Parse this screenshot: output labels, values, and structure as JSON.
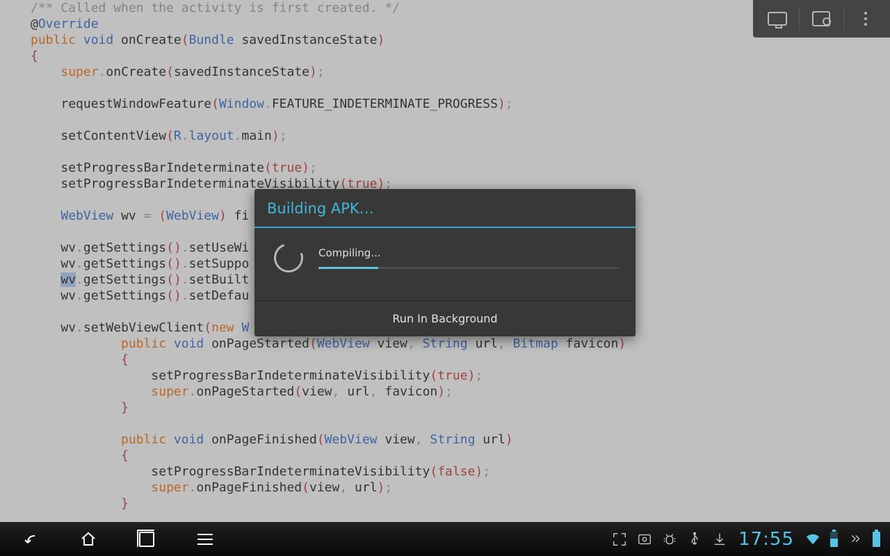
{
  "code": {
    "lines": [
      {
        "indent": 0,
        "tokens": [
          {
            "t": "/** Called when the activity is first created. */",
            "c": "kw-comment"
          }
        ]
      },
      {
        "indent": 0,
        "tokens": [
          {
            "t": "@",
            "c": ""
          },
          {
            "t": "Override",
            "c": "kw-blue"
          }
        ]
      },
      {
        "indent": 0,
        "tokens": [
          {
            "t": "public ",
            "c": "kw-orange"
          },
          {
            "t": "void ",
            "c": "kw-blue"
          },
          {
            "t": "onCreate"
          },
          {
            "t": "(",
            "c": "kw-red"
          },
          {
            "t": "Bundle ",
            "c": "kw-blue"
          },
          {
            "t": "savedInstanceState"
          },
          {
            "t": ")",
            "c": "kw-red"
          }
        ]
      },
      {
        "indent": 0,
        "tokens": [
          {
            "t": "{",
            "c": "kw-red"
          }
        ]
      },
      {
        "indent": 1,
        "tokens": [
          {
            "t": "super",
            "c": "kw-orange"
          },
          {
            "t": ".",
            "c": "kw-grey"
          },
          {
            "t": "onCreate"
          },
          {
            "t": "(",
            "c": "kw-red"
          },
          {
            "t": "savedInstanceState"
          },
          {
            "t": ")",
            "c": "kw-red"
          },
          {
            "t": ";",
            "c": "kw-grey"
          }
        ]
      },
      {
        "indent": 0,
        "tokens": []
      },
      {
        "indent": 1,
        "tokens": [
          {
            "t": "requestWindowFeature"
          },
          {
            "t": "(",
            "c": "kw-red"
          },
          {
            "t": "Window",
            "c": "kw-blue"
          },
          {
            "t": ".",
            "c": "kw-grey"
          },
          {
            "t": "FEATURE_INDETERMINATE_PROGRESS"
          },
          {
            "t": ")",
            "c": "kw-red"
          },
          {
            "t": ";",
            "c": "kw-grey"
          }
        ]
      },
      {
        "indent": 0,
        "tokens": []
      },
      {
        "indent": 1,
        "tokens": [
          {
            "t": "setContentView"
          },
          {
            "t": "(",
            "c": "kw-red"
          },
          {
            "t": "R",
            "c": "kw-blue"
          },
          {
            "t": ".",
            "c": "kw-grey"
          },
          {
            "t": "layout",
            "c": "kw-blue"
          },
          {
            "t": ".",
            "c": "kw-grey"
          },
          {
            "t": "main"
          },
          {
            "t": ")",
            "c": "kw-red"
          },
          {
            "t": ";",
            "c": "kw-grey"
          }
        ]
      },
      {
        "indent": 0,
        "tokens": []
      },
      {
        "indent": 1,
        "tokens": [
          {
            "t": "setProgressBarIndeterminate"
          },
          {
            "t": "(",
            "c": "kw-red"
          },
          {
            "t": "true",
            "c": "kw-redb"
          },
          {
            "t": ")",
            "c": "kw-red"
          },
          {
            "t": ";",
            "c": "kw-grey"
          }
        ]
      },
      {
        "indent": 1,
        "tokens": [
          {
            "t": "setProgressBarIndeterminateVisibility"
          },
          {
            "t": "(",
            "c": "kw-red"
          },
          {
            "t": "true",
            "c": "kw-redb"
          },
          {
            "t": ")",
            "c": "kw-red"
          },
          {
            "t": ";",
            "c": "kw-grey"
          }
        ]
      },
      {
        "indent": 0,
        "tokens": []
      },
      {
        "indent": 1,
        "tokens": [
          {
            "t": "WebView ",
            "c": "kw-blue"
          },
          {
            "t": "wv "
          },
          {
            "t": "= ",
            "c": "kw-grey"
          },
          {
            "t": "(",
            "c": "kw-red"
          },
          {
            "t": "WebView",
            "c": "kw-blue"
          },
          {
            "t": ") ",
            "c": "kw-red"
          },
          {
            "t": "fi"
          }
        ]
      },
      {
        "indent": 0,
        "tokens": []
      },
      {
        "indent": 1,
        "tokens": [
          {
            "t": "wv"
          },
          {
            "t": ".",
            "c": "kw-grey"
          },
          {
            "t": "getSettings"
          },
          {
            "t": "()",
            "c": "kw-red"
          },
          {
            "t": ".",
            "c": "kw-grey"
          },
          {
            "t": "setUseWi"
          }
        ]
      },
      {
        "indent": 1,
        "tokens": [
          {
            "t": "wv"
          },
          {
            "t": ".",
            "c": "kw-grey"
          },
          {
            "t": "getSettings"
          },
          {
            "t": "()",
            "c": "kw-red"
          },
          {
            "t": ".",
            "c": "kw-grey"
          },
          {
            "t": "setSuppo"
          }
        ]
      },
      {
        "indent": 1,
        "tokens": [
          {
            "t": "wv",
            "c": "hl"
          },
          {
            "t": ".",
            "c": "kw-grey"
          },
          {
            "t": "getSettings"
          },
          {
            "t": "()",
            "c": "kw-red"
          },
          {
            "t": ".",
            "c": "kw-grey"
          },
          {
            "t": "setBuilt"
          }
        ]
      },
      {
        "indent": 1,
        "tokens": [
          {
            "t": "wv"
          },
          {
            "t": ".",
            "c": "kw-grey"
          },
          {
            "t": "getSettings"
          },
          {
            "t": "()",
            "c": "kw-red"
          },
          {
            "t": ".",
            "c": "kw-grey"
          },
          {
            "t": "setDefau"
          }
        ]
      },
      {
        "indent": 0,
        "tokens": []
      },
      {
        "indent": 1,
        "tokens": [
          {
            "t": "wv"
          },
          {
            "t": ".",
            "c": "kw-grey"
          },
          {
            "t": "setWebViewClient"
          },
          {
            "t": "(",
            "c": "kw-red"
          },
          {
            "t": "new ",
            "c": "kw-orange"
          },
          {
            "t": "W",
            "c": "kw-blue"
          }
        ]
      },
      {
        "indent": 3,
        "tokens": [
          {
            "t": "public ",
            "c": "kw-orange"
          },
          {
            "t": "void ",
            "c": "kw-blue"
          },
          {
            "t": "onPageStarted"
          },
          {
            "t": "(",
            "c": "kw-red"
          },
          {
            "t": "WebView ",
            "c": "kw-blue"
          },
          {
            "t": "view"
          },
          {
            "t": ", ",
            "c": "kw-grey"
          },
          {
            "t": "String ",
            "c": "kw-blue"
          },
          {
            "t": "url"
          },
          {
            "t": ", ",
            "c": "kw-grey"
          },
          {
            "t": "Bitmap ",
            "c": "kw-blue"
          },
          {
            "t": "favicon"
          },
          {
            "t": ")",
            "c": "kw-red"
          }
        ]
      },
      {
        "indent": 3,
        "tokens": [
          {
            "t": "{",
            "c": "kw-red"
          }
        ]
      },
      {
        "indent": 4,
        "tokens": [
          {
            "t": "setProgressBarIndeterminateVisibility"
          },
          {
            "t": "(",
            "c": "kw-red"
          },
          {
            "t": "true",
            "c": "kw-redb"
          },
          {
            "t": ")",
            "c": "kw-red"
          },
          {
            "t": ";",
            "c": "kw-grey"
          }
        ]
      },
      {
        "indent": 4,
        "tokens": [
          {
            "t": "super",
            "c": "kw-orange"
          },
          {
            "t": ".",
            "c": "kw-grey"
          },
          {
            "t": "onPageStarted"
          },
          {
            "t": "(",
            "c": "kw-red"
          },
          {
            "t": "view"
          },
          {
            "t": ", ",
            "c": "kw-grey"
          },
          {
            "t": "url"
          },
          {
            "t": ", ",
            "c": "kw-grey"
          },
          {
            "t": "favicon"
          },
          {
            "t": ")",
            "c": "kw-red"
          },
          {
            "t": ";",
            "c": "kw-grey"
          }
        ]
      },
      {
        "indent": 3,
        "tokens": [
          {
            "t": "}",
            "c": "kw-red"
          }
        ]
      },
      {
        "indent": 0,
        "tokens": []
      },
      {
        "indent": 3,
        "tokens": [
          {
            "t": "public ",
            "c": "kw-orange"
          },
          {
            "t": "void ",
            "c": "kw-blue"
          },
          {
            "t": "onPageFinished"
          },
          {
            "t": "(",
            "c": "kw-red"
          },
          {
            "t": "WebView ",
            "c": "kw-blue"
          },
          {
            "t": "view"
          },
          {
            "t": ", ",
            "c": "kw-grey"
          },
          {
            "t": "String ",
            "c": "kw-blue"
          },
          {
            "t": "url"
          },
          {
            "t": ")",
            "c": "kw-red"
          }
        ]
      },
      {
        "indent": 3,
        "tokens": [
          {
            "t": "{",
            "c": "kw-red"
          }
        ]
      },
      {
        "indent": 4,
        "tokens": [
          {
            "t": "setProgressBarIndeterminateVisibility"
          },
          {
            "t": "(",
            "c": "kw-red"
          },
          {
            "t": "false",
            "c": "kw-redb"
          },
          {
            "t": ")",
            "c": "kw-red"
          },
          {
            "t": ";",
            "c": "kw-grey"
          }
        ]
      },
      {
        "indent": 4,
        "tokens": [
          {
            "t": "super",
            "c": "kw-orange"
          },
          {
            "t": ".",
            "c": "kw-grey"
          },
          {
            "t": "onPageFinished"
          },
          {
            "t": "(",
            "c": "kw-red"
          },
          {
            "t": "view"
          },
          {
            "t": ", ",
            "c": "kw-grey"
          },
          {
            "t": "url"
          },
          {
            "t": ")",
            "c": "kw-red"
          },
          {
            "t": ";",
            "c": "kw-grey"
          }
        ]
      },
      {
        "indent": 3,
        "tokens": [
          {
            "t": "}",
            "c": "kw-red"
          }
        ]
      }
    ]
  },
  "toolbar": {
    "items": [
      "monitor",
      "device-search",
      "overflow"
    ]
  },
  "modal": {
    "title": "Building APK…",
    "message": "Compiling...",
    "progress_pct": 20,
    "button": "Run In Background"
  },
  "sysbar": {
    "clock": "17:55",
    "status_icons": [
      "expand",
      "screenshot",
      "android-debug",
      "usb",
      "download",
      "wifi",
      "battery-half",
      "chevrons",
      "battery-full"
    ]
  }
}
